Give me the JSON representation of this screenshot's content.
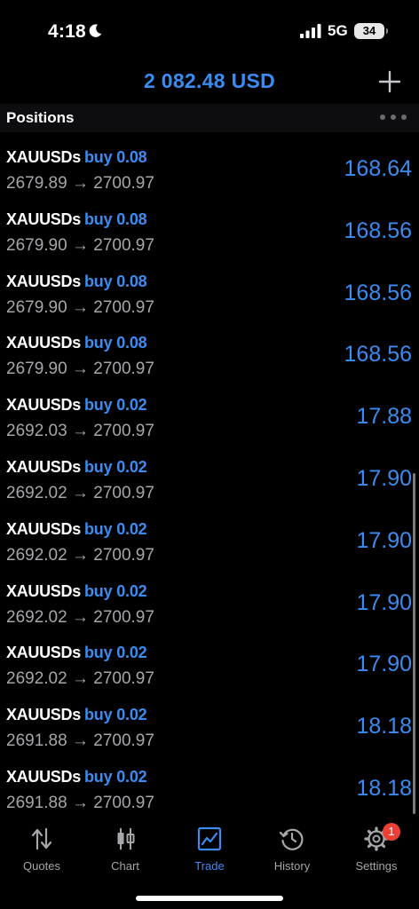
{
  "status_bar": {
    "time": "4:18",
    "network": "5G",
    "battery": "34"
  },
  "header": {
    "balance": "2 082.48 USD"
  },
  "section": {
    "title": "Positions"
  },
  "positions": [
    {
      "symbol": "XAUUSDs",
      "side": "buy 0.08",
      "open_price": "2679.89",
      "current_price": "2700.97",
      "profit": "168.64"
    },
    {
      "symbol": "XAUUSDs",
      "side": "buy 0.08",
      "open_price": "2679.90",
      "current_price": "2700.97",
      "profit": "168.56"
    },
    {
      "symbol": "XAUUSDs",
      "side": "buy 0.08",
      "open_price": "2679.90",
      "current_price": "2700.97",
      "profit": "168.56"
    },
    {
      "symbol": "XAUUSDs",
      "side": "buy 0.08",
      "open_price": "2679.90",
      "current_price": "2700.97",
      "profit": "168.56"
    },
    {
      "symbol": "XAUUSDs",
      "side": "buy 0.02",
      "open_price": "2692.03",
      "current_price": "2700.97",
      "profit": "17.88"
    },
    {
      "symbol": "XAUUSDs",
      "side": "buy 0.02",
      "open_price": "2692.02",
      "current_price": "2700.97",
      "profit": "17.90"
    },
    {
      "symbol": "XAUUSDs",
      "side": "buy 0.02",
      "open_price": "2692.02",
      "current_price": "2700.97",
      "profit": "17.90"
    },
    {
      "symbol": "XAUUSDs",
      "side": "buy 0.02",
      "open_price": "2692.02",
      "current_price": "2700.97",
      "profit": "17.90"
    },
    {
      "symbol": "XAUUSDs",
      "side": "buy 0.02",
      "open_price": "2692.02",
      "current_price": "2700.97",
      "profit": "17.90"
    },
    {
      "symbol": "XAUUSDs",
      "side": "buy 0.02",
      "open_price": "2691.88",
      "current_price": "2700.97",
      "profit": "18.18"
    },
    {
      "symbol": "XAUUSDs",
      "side": "buy 0.02",
      "open_price": "2691.88",
      "current_price": "2700.97",
      "profit": "18.18"
    }
  ],
  "tabs": [
    {
      "label": "Quotes",
      "icon": "quotes-arrows-icon",
      "active": false
    },
    {
      "label": "Chart",
      "icon": "candlestick-icon",
      "active": false
    },
    {
      "label": "Trade",
      "icon": "trade-chart-icon",
      "active": true
    },
    {
      "label": "History",
      "icon": "history-clock-icon",
      "active": false
    },
    {
      "label": "Settings",
      "icon": "gear-icon",
      "active": false,
      "badge": "1"
    }
  ],
  "colors": {
    "accent": "#3b8cf2",
    "secondary_text": "#a6a6ab",
    "badge": "#eb4034",
    "background": "#000000"
  }
}
